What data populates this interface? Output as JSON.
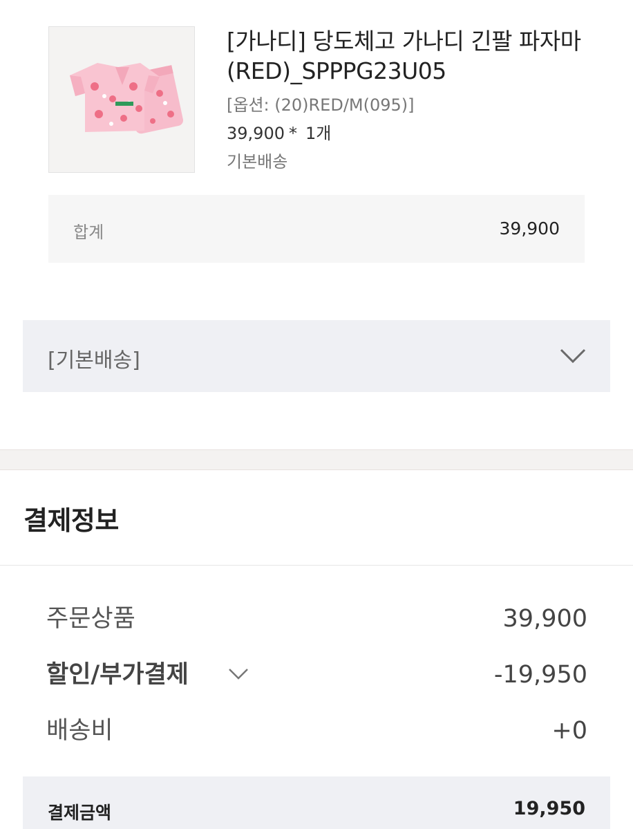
{
  "product": {
    "name": "[가나디] 당도체고 가나디 긴팔 파자마(RED)_SPPPG23U05",
    "option": "[옵션: (20)RED/M(095)]",
    "price": "39,900",
    "multiplier": "*",
    "quantity": "1개",
    "shipping": "기본배송",
    "image_icon": "pajama-product-image"
  },
  "subtotal": {
    "label": "합계",
    "value": "39,900"
  },
  "shipping_group": {
    "label": "[기본배송]",
    "icon": "chevron-down-icon"
  },
  "payment": {
    "title": "결제정보",
    "rows": [
      {
        "label": "주문상품",
        "value": "39,900"
      },
      {
        "label": "할인/부가결제",
        "value": "-19,950"
      },
      {
        "label": "배송비",
        "value": "+0"
      }
    ],
    "total": {
      "label": "결제금액",
      "value": "19,950"
    }
  },
  "colors": {
    "panel_gray": "#f6f6f6",
    "panel_blue_gray": "#eff0f4",
    "divider_band": "#f4f2f1",
    "product_pink": "#f6b3c2"
  }
}
